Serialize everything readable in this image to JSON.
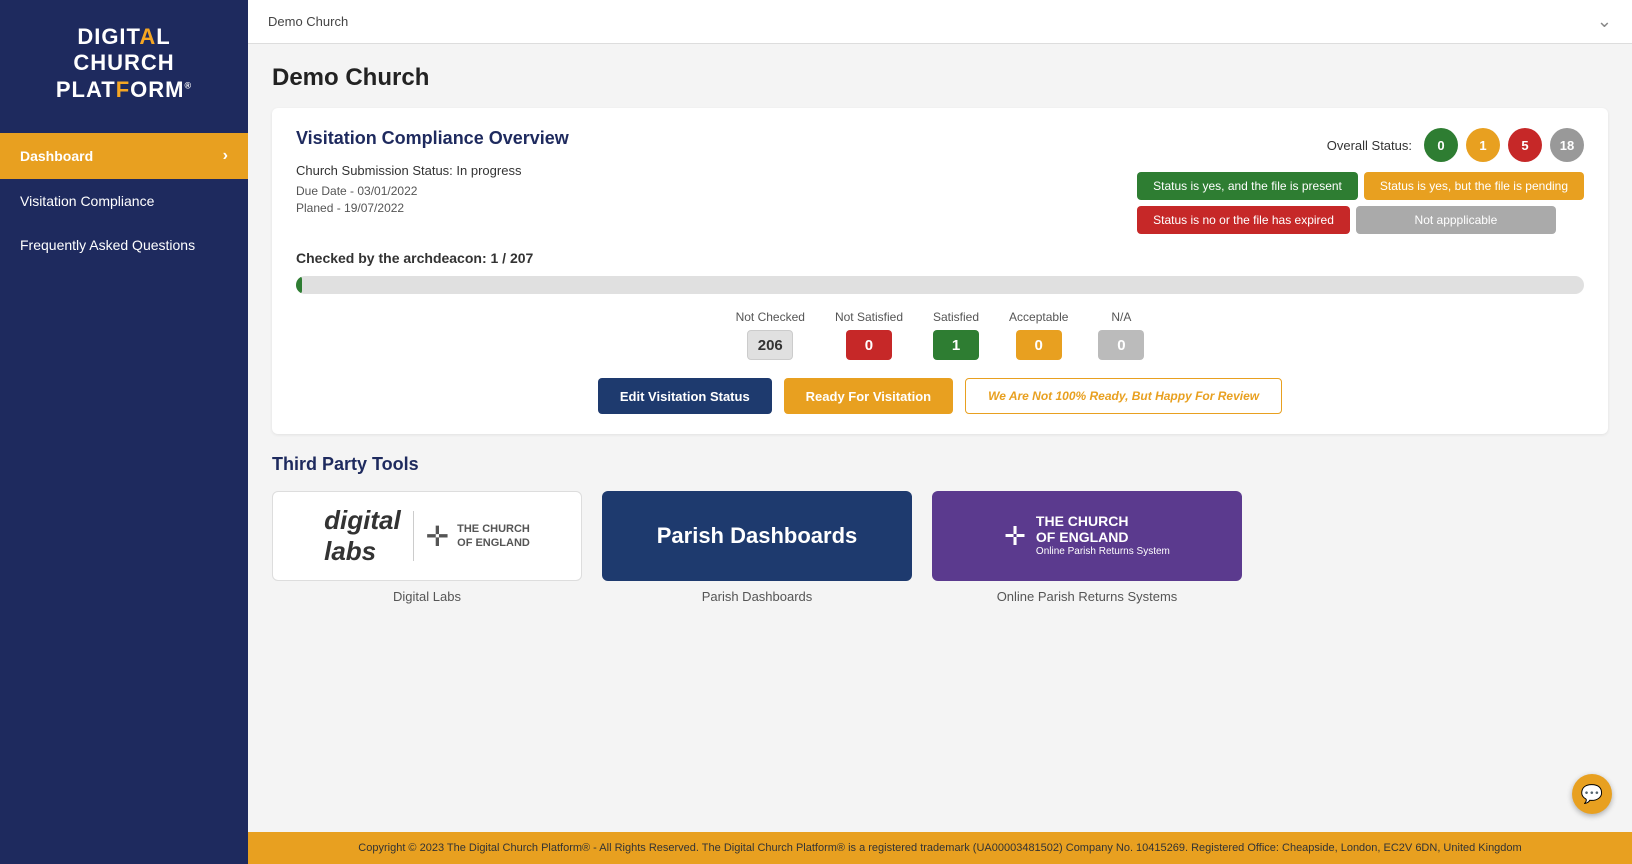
{
  "sidebar": {
    "logo": {
      "line1": "DIGIT",
      "line1_highlight": "A",
      "line1_rest": "L",
      "line2": "CHURCH",
      "line3": "PLAT",
      "line3_highlight": "F",
      "line3_rest": "ORM",
      "reg": "®"
    },
    "nav_items": [
      {
        "id": "dashboard",
        "label": "Dashboard",
        "active": true
      },
      {
        "id": "visitation-compliance",
        "label": "Visitation Compliance",
        "active": false
      },
      {
        "id": "faq",
        "label": "Frequently Asked Questions",
        "active": false
      }
    ]
  },
  "topbar": {
    "breadcrumb": "Demo Church"
  },
  "main": {
    "page_title": "Demo Church",
    "visitation": {
      "section_title": "Visitation Compliance Overview",
      "submission_label": "Church Submission Status:",
      "submission_value": "In progress",
      "due_date": "Due Date - 03/01/2022",
      "planned_date": "Planed - 19/07/2022",
      "overall_status_label": "Overall Status:",
      "badges": [
        {
          "value": "0",
          "color": "green"
        },
        {
          "value": "1",
          "color": "yellow"
        },
        {
          "value": "5",
          "color": "red"
        },
        {
          "value": "18",
          "color": "gray"
        }
      ],
      "legend": [
        {
          "text": "Status is yes, and the file is present",
          "color": "green"
        },
        {
          "text": "Status is yes, but the file is pending",
          "color": "yellow"
        },
        {
          "text": "Status is no or the file has expired",
          "color": "red"
        },
        {
          "text": "Not appplicable",
          "color": "gray"
        }
      ],
      "progress_label": "Checked by the archdeacon: 1 / 207",
      "progress_percent": 0.5,
      "status_counts": [
        {
          "label": "Not Checked",
          "value": "206",
          "color": "gray"
        },
        {
          "label": "Not Satisfied",
          "value": "0",
          "color": "red"
        },
        {
          "label": "Satisfied",
          "value": "1",
          "color": "green"
        },
        {
          "label": "Acceptable",
          "value": "0",
          "color": "yellow"
        },
        {
          "label": "N/A",
          "value": "0",
          "color": "light-gray"
        }
      ],
      "buttons": [
        {
          "id": "edit-visitation",
          "label": "Edit Visitation Status",
          "style": "blue"
        },
        {
          "id": "ready-visitation",
          "label": "Ready For Visitation",
          "style": "yellow"
        },
        {
          "id": "not-ready",
          "label": "We Are Not 100% Ready, But Happy For Review",
          "style": "outline-yellow"
        }
      ]
    },
    "third_party": {
      "title": "Third Party Tools",
      "tools": [
        {
          "id": "digital-labs",
          "name": "Digital Labs",
          "type": "digital-labs"
        },
        {
          "id": "parish-dashboards",
          "name": "Parish Dashboards",
          "type": "parish"
        },
        {
          "id": "online-parish",
          "name": "Online Parish Returns Systems",
          "type": "england"
        }
      ]
    }
  },
  "footer": {
    "text": "Copyright © 2023 The Digital Church Platform® - All Rights Reserved. The Digital Church Platform® is a registered trademark (UA00003481502) Company No. 10415269. Registered Office: Cheapside, London, EC2V 6DN, United Kingdom"
  }
}
